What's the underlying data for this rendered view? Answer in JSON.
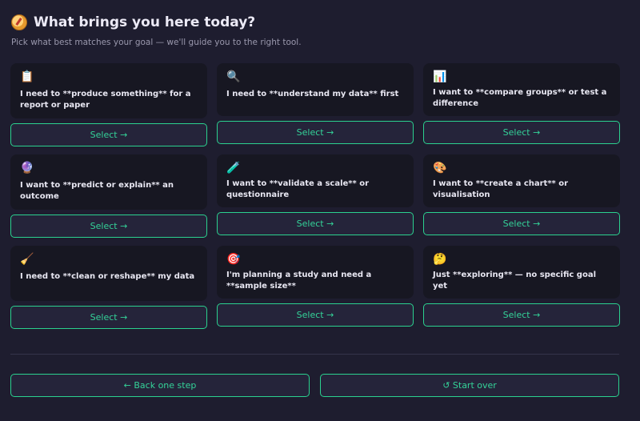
{
  "header": {
    "title": "What brings you here today?",
    "subtitle": "Pick what best matches your goal — we'll guide you to the right tool."
  },
  "options": [
    {
      "icon": "📋",
      "text": "I need to **produce something** for a report or paper",
      "button": "Select →"
    },
    {
      "icon": "🔍",
      "text": "I need to **understand my data** first",
      "button": "Select →"
    },
    {
      "icon": "📊",
      "text": "I want to **compare groups** or test a difference",
      "button": "Select →"
    },
    {
      "icon": "🔮",
      "text": "I want to **predict or explain** an outcome",
      "button": "Select →"
    },
    {
      "icon": "🧪",
      "text": "I want to **validate a scale** or questionnaire",
      "button": "Select →"
    },
    {
      "icon": "🎨",
      "text": "I want to **create a chart** or visualisation",
      "button": "Select →"
    },
    {
      "icon": "🧹",
      "text": "I need to **clean or reshape** my data",
      "button": "Select →"
    },
    {
      "icon": "🎯",
      "text": "I'm planning a study and need a **sample size**",
      "button": "Select →"
    },
    {
      "icon": "🤔",
      "text": "Just **exploring** — no specific goal yet",
      "button": "Select →"
    }
  ],
  "footer": {
    "back_label": "← Back one step",
    "restart_label": "↺ Start over"
  },
  "colors": {
    "background": "#1e1d2f",
    "card": "#171722",
    "accent": "#2bd18f"
  }
}
